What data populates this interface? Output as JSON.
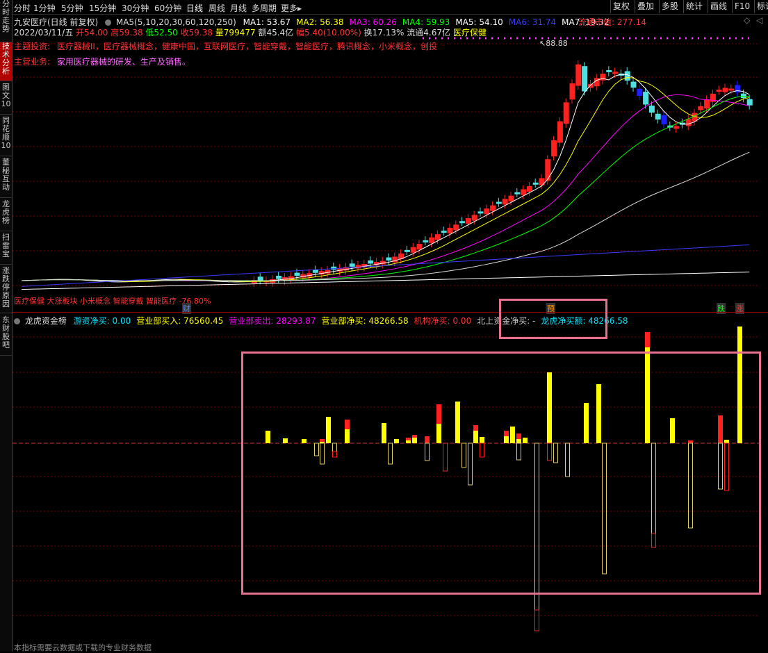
{
  "sidebar": {
    "tabs": [
      {
        "label": "分时走势",
        "active": false
      },
      {
        "label": "技术分析",
        "active": true
      },
      {
        "label": "图文10",
        "active": false
      },
      {
        "label": "同花顺10",
        "active": false
      },
      {
        "label": "董秘互动",
        "active": false
      },
      {
        "label": "龙虎榜",
        "active": false
      },
      {
        "label": "扫雷宝",
        "active": false
      },
      {
        "label": "涨跌停原因",
        "active": false
      },
      {
        "label": "东财股吧",
        "active": false
      }
    ]
  },
  "toolbar": {
    "periods": [
      "分时",
      "1分钟",
      "5分钟",
      "15分钟",
      "30分钟",
      "60分钟",
      "日线",
      "周线",
      "月线",
      "多周期",
      "更多"
    ],
    "active_period": "日线",
    "more_arrow": "▸",
    "right_buttons": [
      "复权",
      "叠加",
      "多股",
      "统计",
      "画线",
      "F10",
      "标记"
    ]
  },
  "header": {
    "title": "九安医疗(日线 前复权)",
    "ma_params": "MA5(5,10,20,30,60,120,250)",
    "ma_values": [
      {
        "label": "MA1: 53.67",
        "color": "#ffffff"
      },
      {
        "label": "MA2: 56.38",
        "color": "#ffff00"
      },
      {
        "label": "MA3: 60.26",
        "color": "#ff00ff"
      },
      {
        "label": "MA4: 59.93",
        "color": "#00ff00"
      },
      {
        "label": "MA5: 54.10",
        "color": "#ffffff"
      },
      {
        "label": "MA6: 31.74",
        "color": "#3a3aff"
      },
      {
        "label": "MA7: 19.32",
        "color": "#ffffff"
      }
    ],
    "market_cap": "流通市值: 277.14",
    "date": "2022/03/11/五",
    "open": "开54.00",
    "high": "高59.38",
    "low": "低52.50",
    "close": "收59.38",
    "volume": "量799477",
    "amount": "额45.4亿",
    "change": "幅5.40(10.00%)",
    "turnover": "换17.13%",
    "float": "流通4.67亿",
    "sector": "医疗保健",
    "theme_label": "主题投资:",
    "themes": "医疗器械II，医疗器械概念，健康中国，互联网医疗，智能穿戴，智能医疗，腾讯概念，小米概念，创投",
    "business_label": "主营业务:",
    "business": "家用医疗器械的研发、生产及销售。"
  },
  "kline": {
    "peak_label": "88.88",
    "bottom_tags": "医疗保健 大涨板块 小米概念 智能穿戴 智能医疗 -76.80%",
    "markers": [
      {
        "text": "财",
        "color": "#4a8cff"
      },
      {
        "text": "预",
        "color": "#ff9900"
      },
      {
        "text": "跌",
        "color": "#00ff00"
      },
      {
        "text": "涨",
        "color": "#ff3333"
      }
    ]
  },
  "indicator": {
    "title": "龙虎资金榜",
    "items": [
      {
        "label": "游资净买: 0.00",
        "color": "#00e5ff"
      },
      {
        "label": "营业部买入: 76560.45",
        "color": "#ffff00"
      },
      {
        "label": "营业部卖出: 28293.87",
        "color": "#ff00ff"
      },
      {
        "label": "营业部净买: 48266.58",
        "color": "#ffff00"
      },
      {
        "label": "机构净买: 0.00",
        "color": "#ff3333"
      },
      {
        "label": "北上资金净买: -",
        "color": "#cccccc"
      },
      {
        "label": "龙虎净买额: 48266.58",
        "color": "#00e5ff"
      }
    ],
    "footer_note": "本指标需要云数据或下载的专业财务数据"
  },
  "colors": {
    "up": "#ff2020",
    "down_cyan": "#50e0e0",
    "down_blue": "#2020ff",
    "buy": "#ffff00",
    "sell_outline": "#e0d060",
    "highlight": "#e8708f"
  }
}
